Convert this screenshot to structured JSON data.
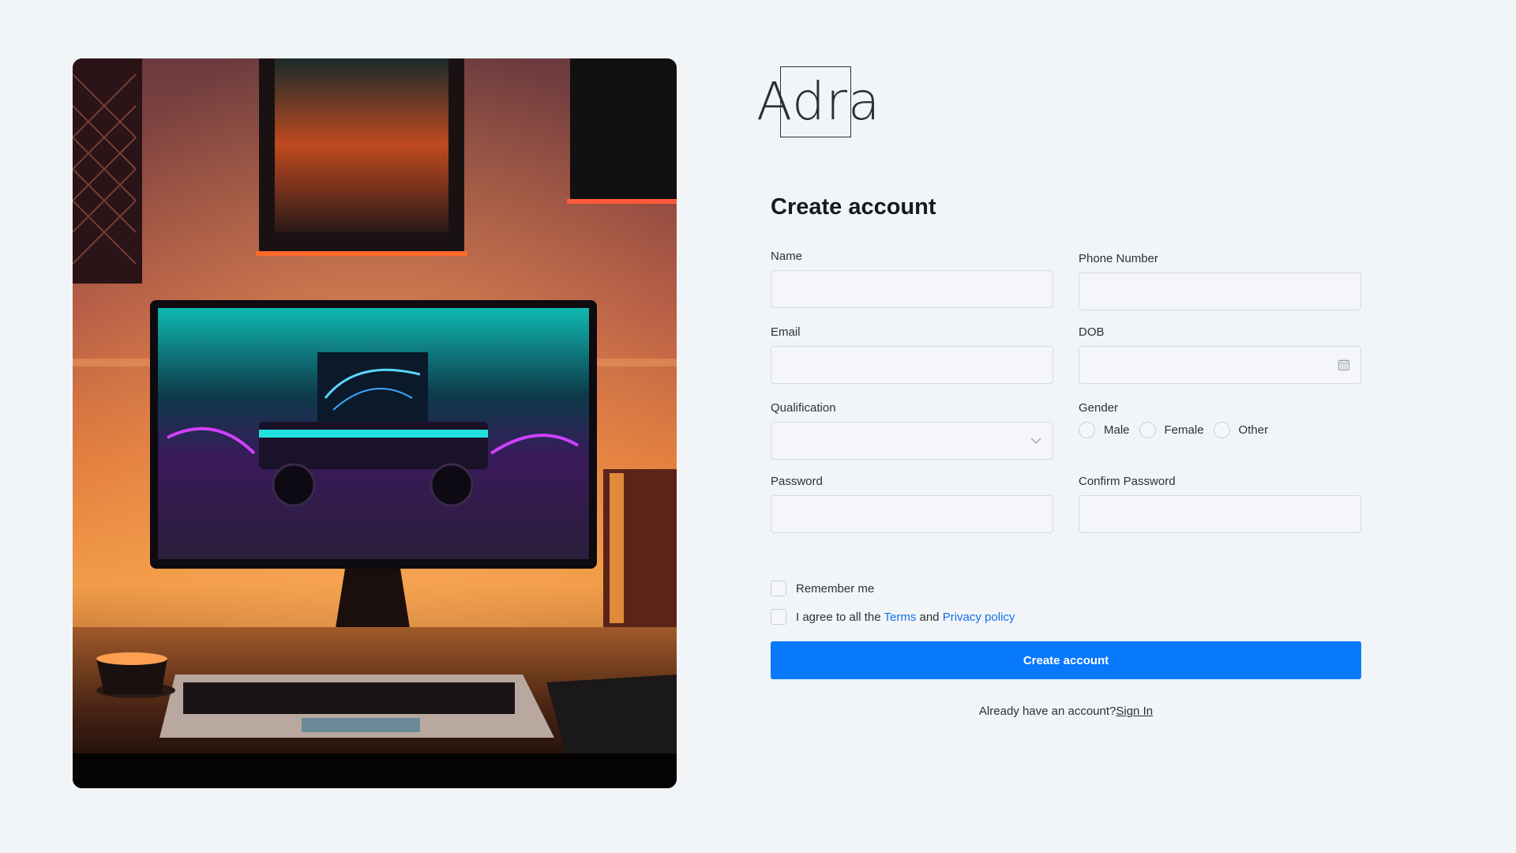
{
  "brand": {
    "logo_text": "Adra"
  },
  "form": {
    "title": "Create account",
    "fields": {
      "name": {
        "label": "Name",
        "value": "",
        "placeholder": ""
      },
      "phone": {
        "label": "Phone Number",
        "value": "",
        "placeholder": ""
      },
      "email": {
        "label": "Email",
        "value": "",
        "placeholder": ""
      },
      "dob": {
        "label": "DOB",
        "value": "",
        "placeholder": "",
        "icon": "calendar-icon"
      },
      "qualification": {
        "label": "Qualification",
        "selected": "",
        "icon": "chevron-down-icon"
      },
      "gender": {
        "label": "Gender",
        "options": [
          "Male",
          "Female",
          "Other"
        ]
      },
      "password": {
        "label": "Password",
        "value": "",
        "placeholder": ""
      },
      "confirm_password": {
        "label": "Confirm Password",
        "value": "",
        "placeholder": ""
      }
    },
    "remember_me": "Remember me",
    "agree": {
      "prefix": "I agree to all the",
      "terms": "Terms",
      "and": "and",
      "privacy": "Privacy policy"
    },
    "submit_label": "Create account",
    "signin": {
      "prompt": "Already have an account?",
      "link": "Sign In"
    }
  },
  "colors": {
    "background": "#f2f5f8",
    "primary": "#0878fd",
    "link": "#1470e6",
    "border": "#d5dbe2"
  }
}
